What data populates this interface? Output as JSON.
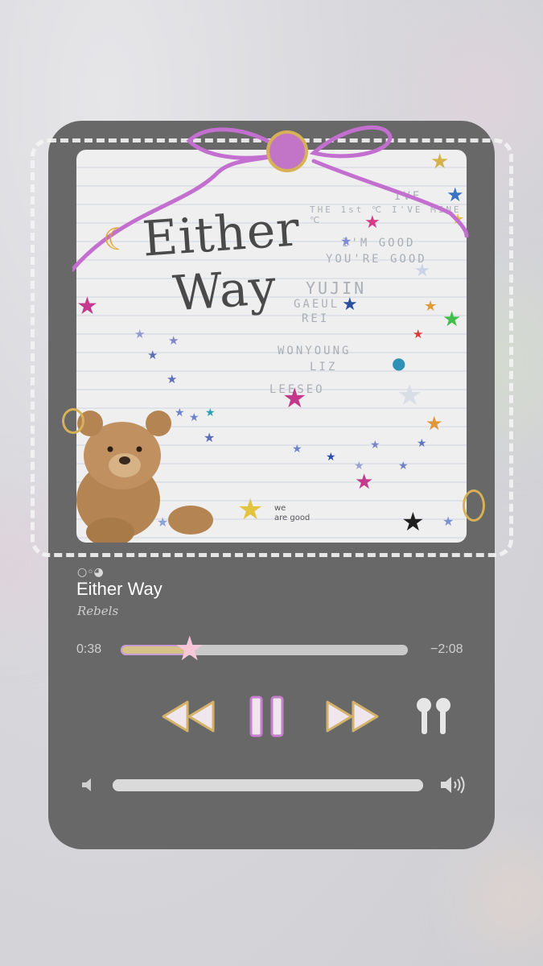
{
  "artwork": {
    "title_line1": "Either",
    "title_line2": "Way",
    "faint_lines": [
      "IVE",
      "THE 1st ℃ I'VE MINE ℃",
      "I'M GOOD",
      "YOU'RE GOOD",
      "YUJIN",
      "GAEUL",
      "REI",
      "WONYOUNG",
      "LIZ",
      "LEESEO"
    ],
    "note_line1": "we",
    "note_line2": "are good"
  },
  "now_playing": {
    "title": "Either Way",
    "artist": "Rebels"
  },
  "progress": {
    "elapsed": "0:38",
    "remaining": "−2:08",
    "fraction": 0.24
  },
  "volume": {
    "fraction": 1.0
  },
  "controls": {
    "rewind": "rewind-icon",
    "pause": "pause-icon",
    "forward": "fast-forward-icon",
    "airpods": "airpods-icon"
  },
  "colors": {
    "card": "#686868",
    "text": "#ffffff",
    "accent_gold": "#d4b26a",
    "accent_purple": "#c77fd0",
    "pink_star": "#f7c7d9"
  }
}
